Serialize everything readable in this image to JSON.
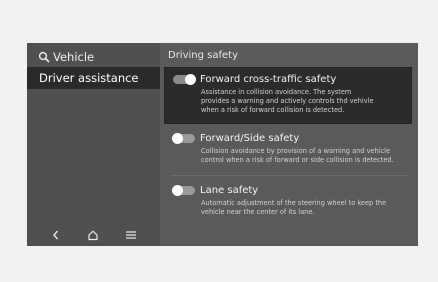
{
  "sidebar": {
    "header_label": "Vehicle",
    "header_icon": "search-icon",
    "active_item": "Driver assistance",
    "nav": [
      {
        "icon": "back-icon",
        "glyph": "<"
      },
      {
        "icon": "home-icon",
        "glyph": "⌂"
      },
      {
        "icon": "menu-icon",
        "glyph": "≡"
      }
    ]
  },
  "main": {
    "title": "Driving safety",
    "items": [
      {
        "title": "Forward cross-traffic safety",
        "description": "Assistance in collision avoidance. The system\nprovides a warning and actively controls thd vehivle\nwhen a risk of forward collision is detected.",
        "enabled": true,
        "selected": true
      },
      {
        "title": "Forward/Side safety",
        "description": "Collision avoidance by provision of a warning and vehicle\ncontrol when a risk of forward or side collision is detected.",
        "enabled": false,
        "selected": false
      },
      {
        "title": "Lane safety",
        "description": "Automatic adjustment of the steering wheel to keep the\nvehicle near the center of its lane.",
        "enabled": false,
        "selected": false
      }
    ]
  },
  "colors": {
    "screen_bg": "#5a5a5a",
    "sidebar_bg": "#505050",
    "selected_bg": "#2b2b2b"
  }
}
